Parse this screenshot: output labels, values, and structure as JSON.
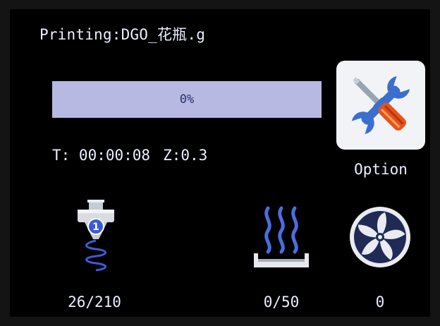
{
  "print": {
    "title": "Printing:DGO_花瓶.g",
    "progress_percent": 0,
    "progress_label": "0%",
    "time_label": "T: 00:00:08",
    "z_label": "Z:0.3"
  },
  "option": {
    "label": "Option",
    "icon": "tools-icon"
  },
  "nozzle": {
    "icon": "extruder-nozzle-icon",
    "extruder_number": "1",
    "value": "26/210"
  },
  "bed": {
    "icon": "heated-bed-icon",
    "value": "0/50"
  },
  "fan": {
    "icon": "fan-icon",
    "value": "0"
  },
  "colors": {
    "screen_bg": "#000000",
    "text": "#ecefff",
    "progress_track": "#b7b9e3",
    "progress_fill": "#4a5cd8",
    "accent_blue": "#3b5bd6"
  }
}
